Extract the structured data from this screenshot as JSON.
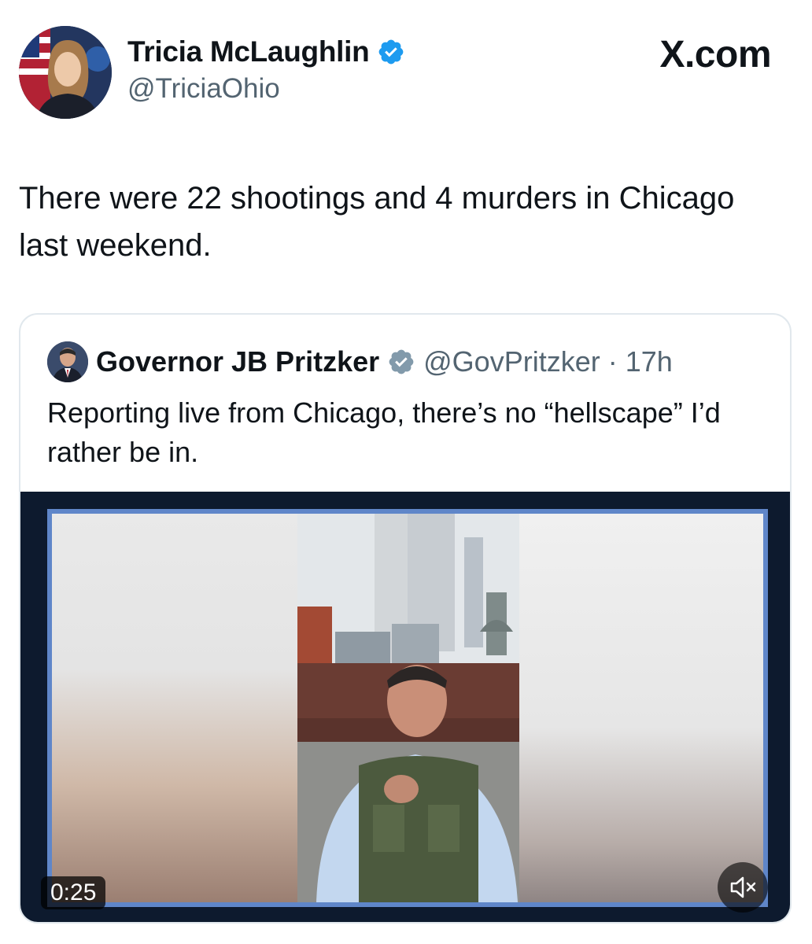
{
  "tweet": {
    "author_name": "Tricia McLaughlin",
    "author_handle": "@TriciaOhio",
    "source": "X.com",
    "text": "There were 22 shootings and 4 murders in Chicago last weekend."
  },
  "quoted": {
    "author_name": "Governor JB Pritzker",
    "author_handle": "@GovPritzker",
    "separator": "·",
    "time": "17h",
    "text": "Reporting live from Chicago, there’s no “hellscape” I’d rather be in.",
    "video_duration": "0:25"
  },
  "colors": {
    "verified_blue": "#1d9bf0",
    "verified_gray": "#829aab",
    "text_primary": "#0f1419",
    "text_secondary": "#536471",
    "video_frame": "#5f86c9"
  },
  "icons": {
    "verified": "verified-badge-icon",
    "gov_verified": "gray-verified-badge-icon",
    "x_logo": "x-logo-icon",
    "mute": "speaker-muted-icon"
  }
}
